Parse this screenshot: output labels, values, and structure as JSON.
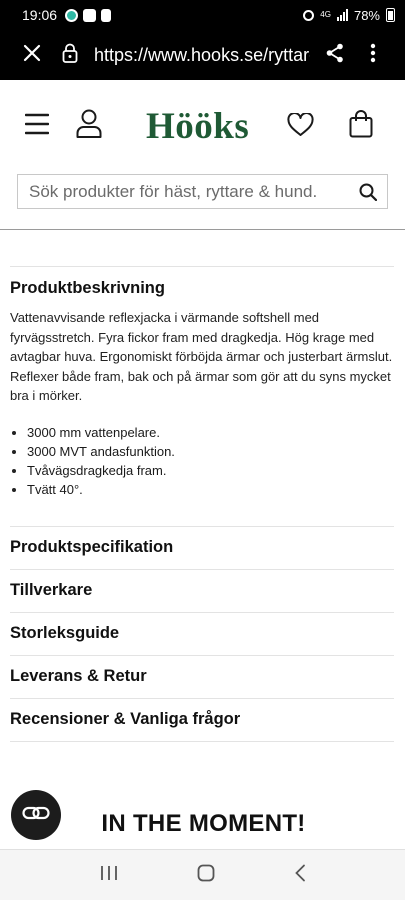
{
  "status_bar": {
    "time": "19:06",
    "network": "4G",
    "battery": "78%"
  },
  "browser": {
    "url": "https://www.hooks.se/ryttare"
  },
  "site": {
    "logo": "Hööks",
    "search_placeholder": "Sök produkter för häst, ryttare & hund."
  },
  "product": {
    "description_title": "Produktbeskrivning",
    "description": "Vattenavvisande reflexjacka i värmande softshell med fyrvägsstretch. Fyra fickor fram med dragkedja. Hög krage med avtagbar huva. Ergonomiskt förböjda ärmar och justerbart ärmslut. Reflexer både fram, bak och på ärmar som gör att du syns mycket bra i mörker.",
    "features": [
      "3000 mm vattenpelare.",
      "3000 MVT andasfunktion.",
      "Tvåvägsdragkedja fram.",
      "Tvätt 40°."
    ],
    "accordions": [
      "Produktspecifikation",
      "Tillverkare",
      "Storleksguide",
      "Leverans & Retur",
      "Recensioner & Vanliga frågor"
    ]
  },
  "banner": {
    "heading": "IN THE MOMENT!"
  },
  "colors": {
    "brand_green": "#1f5a35",
    "chrome": "#000000"
  }
}
